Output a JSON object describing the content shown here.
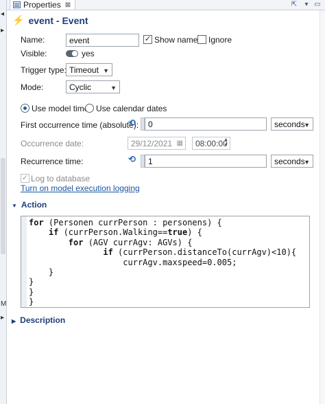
{
  "tab": {
    "label": "Properties",
    "close": "⊠"
  },
  "title": {
    "text": "event - Event"
  },
  "fields": {
    "name_label": "Name:",
    "name_value": "event",
    "show_name_label": "Show name",
    "show_name_checked": "✓",
    "ignore_label": "Ignore",
    "visible_label": "Visible:",
    "visible_value": "yes",
    "trigger_label": "Trigger type:",
    "trigger_value": "Timeout",
    "mode_label": "Mode:",
    "mode_value": "Cyclic",
    "use_model_time": "Use model time",
    "use_calendar_dates": "Use calendar dates",
    "first_occurrence_label": "First occurrence time (absolute):",
    "first_occurrence_value": "0",
    "first_occurrence_unit": "seconds",
    "occurrence_date_label": "Occurrence date:",
    "occurrence_date_value": "29/12/2021",
    "occurrence_time_value": "08:00:00",
    "recurrence_label": "Recurrence time:",
    "recurrence_value": "1",
    "recurrence_unit": "seconds",
    "log_label": "Log to database",
    "log_checked": "✓",
    "logging_link": "Turn on model execution logging"
  },
  "sections": {
    "action": "Action",
    "description": "Description"
  },
  "code": {
    "lines": [
      "for (Personen currPerson : personens) {",
      "    if (currPerson.Walking==true) {",
      "        for (AGV currAgv: AGVs) {",
      "               if (currPerson.distanceTo(currAgv)<10){",
      "                   currAgv.maxspeed=0.005;",
      "    }",
      "}",
      "}",
      "}"
    ]
  },
  "colors": {
    "accent": "#1f3e7a",
    "link": "#1a55a6",
    "refresh": "#2f6fb9",
    "bolt": "#e0a000"
  },
  "icons": [
    "properties-icon",
    "close-icon",
    "lightning-icon",
    "refresh-icon",
    "calendar-icon",
    "spinner-icon",
    "chevron-down-icon",
    "triangle-down-icon",
    "triangle-right-icon"
  ]
}
